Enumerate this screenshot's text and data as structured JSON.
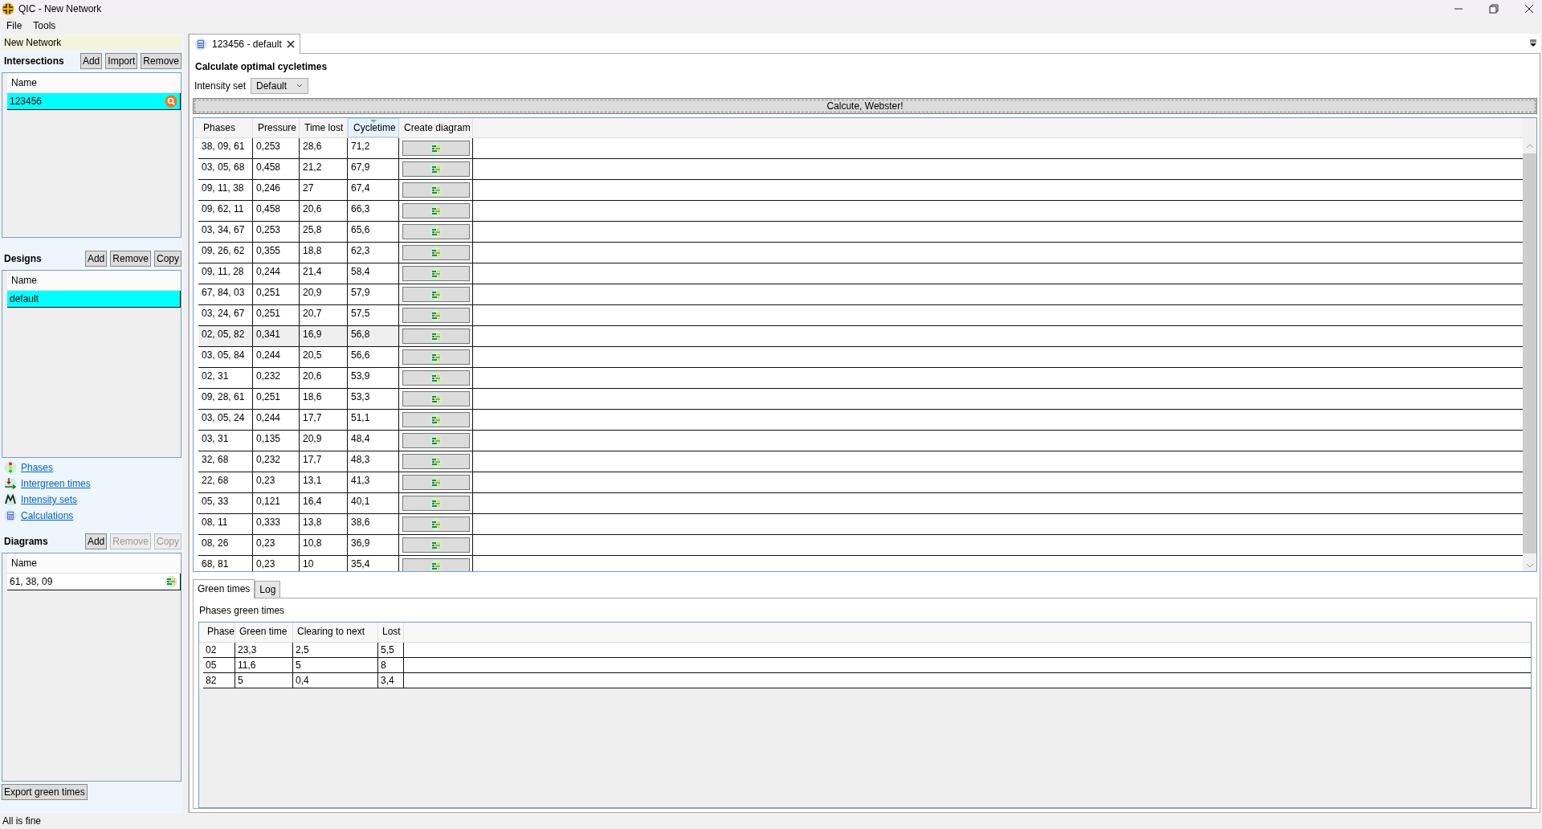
{
  "window": {
    "title": "QIC - New Network"
  },
  "menu": [
    {
      "label": "File"
    },
    {
      "label": "Tools"
    }
  ],
  "network_name": "New Network",
  "intersections": {
    "title": "Intersections",
    "buttons": [
      {
        "label": "Add",
        "disabled": false
      },
      {
        "label": "Import",
        "disabled": false
      },
      {
        "label": "Remove",
        "disabled": false
      }
    ],
    "column": "Name",
    "items": [
      {
        "name": "123456",
        "selected": true,
        "kind": "search"
      }
    ]
  },
  "designs": {
    "title": "Designs",
    "buttons": [
      {
        "label": "Add",
        "disabled": false
      },
      {
        "label": "Remove",
        "disabled": false
      },
      {
        "label": "Copy",
        "disabled": false
      }
    ],
    "column": "Name",
    "items": [
      {
        "name": "default",
        "selected": true
      }
    ]
  },
  "links": [
    {
      "label": "Phases",
      "kind": "phases"
    },
    {
      "label": "Intergreen times",
      "kind": "intergreen"
    },
    {
      "label": "Intensity sets",
      "kind": "intensity"
    },
    {
      "label": "Calculations",
      "kind": "calculator"
    }
  ],
  "diagrams": {
    "title": "Diagrams",
    "buttons": [
      {
        "label": "Add",
        "disabled": false
      },
      {
        "label": "Remove",
        "disabled": true
      },
      {
        "label": "Copy",
        "disabled": true
      }
    ],
    "column": "Name",
    "items": [
      {
        "name": "61, 38, 09",
        "selected": false,
        "kind": "diagram"
      }
    ]
  },
  "export_button": "Export green times",
  "document_tab": {
    "label": "123456 - default",
    "selected": true
  },
  "calculation": {
    "title": "Calculate optimal cycletimes",
    "intensity_label": "Intensity set",
    "intensity_value": "Default",
    "run_button": "Calcute, Webster!",
    "columns": [
      {
        "label": "Phases",
        "sorted": false
      },
      {
        "label": "Pressure",
        "sorted": false
      },
      {
        "label": "Time lost",
        "sorted": false
      },
      {
        "label": "Cycletime",
        "sorted": true
      },
      {
        "label": "Create diagram",
        "sorted": false
      }
    ],
    "rows": [
      {
        "cells": [
          "38, 09, 61",
          "0,253",
          "28,6",
          "71,2"
        ],
        "selected": false
      },
      {
        "cells": [
          "03, 05, 68",
          "0,458",
          "21,2",
          "67,9"
        ],
        "selected": false
      },
      {
        "cells": [
          "09, 11, 38",
          "0,246",
          "27",
          "67,4"
        ],
        "selected": false
      },
      {
        "cells": [
          "09, 62, 11",
          "0,458",
          "20,6",
          "66,3"
        ],
        "selected": false
      },
      {
        "cells": [
          "03, 34, 67",
          "0,253",
          "25,8",
          "65,6"
        ],
        "selected": false
      },
      {
        "cells": [
          "09, 26, 62",
          "0,355",
          "18,8",
          "62,3"
        ],
        "selected": false
      },
      {
        "cells": [
          "09, 11, 28",
          "0,244",
          "21,4",
          "58,4"
        ],
        "selected": false
      },
      {
        "cells": [
          "67, 84, 03",
          "0,251",
          "20,9",
          "57,9"
        ],
        "selected": false
      },
      {
        "cells": [
          "03, 24, 67",
          "0,251",
          "20,7",
          "57,5"
        ],
        "selected": false
      },
      {
        "cells": [
          "02, 05, 82",
          "0,341",
          "16,9",
          "56,8"
        ],
        "selected": true
      },
      {
        "cells": [
          "03, 05, 84",
          "0,244",
          "20,5",
          "56,6"
        ],
        "selected": false
      },
      {
        "cells": [
          "02, 31",
          "0,232",
          "20,6",
          "53,9"
        ],
        "selected": false
      },
      {
        "cells": [
          "09, 28, 61",
          "0,251",
          "18,6",
          "53,3"
        ],
        "selected": false
      },
      {
        "cells": [
          "03, 05, 24",
          "0,244",
          "17,7",
          "51,1"
        ],
        "selected": false
      },
      {
        "cells": [
          "03, 31",
          "0,135",
          "20,9",
          "48,4"
        ],
        "selected": false
      },
      {
        "cells": [
          "32, 68",
          "0,232",
          "17,7",
          "48,3"
        ],
        "selected": false
      },
      {
        "cells": [
          "22, 68",
          "0,23",
          "13,1",
          "41,3"
        ],
        "selected": false
      },
      {
        "cells": [
          "05, 33",
          "0,121",
          "16,4",
          "40,1"
        ],
        "selected": false
      },
      {
        "cells": [
          "08, 11",
          "0,333",
          "13,8",
          "38,6"
        ],
        "selected": false
      },
      {
        "cells": [
          "08, 26",
          "0,23",
          "10,8",
          "36,9"
        ],
        "selected": false
      },
      {
        "cells": [
          "68, 81",
          "0,23",
          "10",
          "35,4"
        ],
        "selected": false
      }
    ]
  },
  "result_tabs": [
    {
      "label": "Green times",
      "selected": true
    },
    {
      "label": "Log",
      "selected": false
    }
  ],
  "green_times": {
    "title": "Phases green times",
    "columns": [
      "Phase",
      "Green time",
      "Clearing to next",
      "Lost"
    ],
    "rows": [
      [
        "02",
        "23,3",
        "2,5",
        "5,5"
      ],
      [
        "05",
        "11,6",
        "5",
        "8"
      ],
      [
        "82",
        "5",
        "0,4",
        "3,4"
      ]
    ]
  },
  "status_bar": "All is fine"
}
